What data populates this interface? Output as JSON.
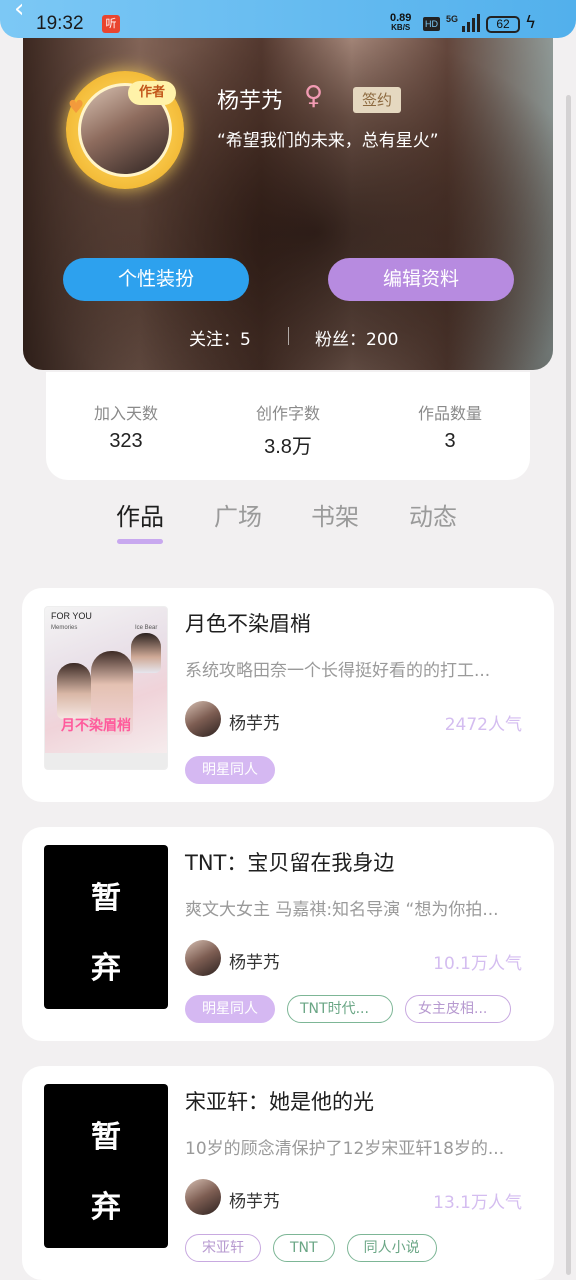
{
  "status_bar": {
    "time": "19:32",
    "app_icon_label": "听",
    "net_speed_value": "0.89",
    "net_speed_unit": "KB/S",
    "hd_label": "HD",
    "signal_label": "5G",
    "battery": "62"
  },
  "profile": {
    "avatar_badge": "作者",
    "name": "杨芋艿",
    "gender_icon": "♀",
    "sign_badge": "签约",
    "bio": "“希望我们的未来，总有星火”",
    "dress_button": "个性装扮",
    "edit_button": "编辑资料",
    "following_label": "关注：",
    "following_count": "5",
    "followers_label": "粉丝：",
    "followers_count": "200"
  },
  "stats": [
    {
      "label": "加入天数",
      "value": "323"
    },
    {
      "label": "创作字数",
      "value": "3.8万"
    },
    {
      "label": "作品数量",
      "value": "3"
    }
  ],
  "tabs": [
    {
      "label": "作品",
      "active": true
    },
    {
      "label": "广场",
      "active": false
    },
    {
      "label": "书架",
      "active": false
    },
    {
      "label": "动态",
      "active": false
    }
  ],
  "works": [
    {
      "title": "月色不染眉梢",
      "description": "系统攻略田奈一个长得挺好看的的打工...",
      "author": "杨芋艿",
      "popularity": "2472人气",
      "cover": {
        "type": "photo",
        "text_top": "FOR YOU",
        "text_sub_left": "Memories",
        "text_sub_right": "Ice Bear",
        "pink_title": "月不染眉梢"
      },
      "tags": [
        {
          "label": "明星同人",
          "style": "purple-fill"
        }
      ]
    },
    {
      "title": "TNT：宝贝留在我身边",
      "description": "爽文大女主 马嘉祺:知名导演 “想为你拍...",
      "author": "杨芋艿",
      "popularity": "10.1万人气",
      "cover": {
        "type": "black",
        "line1": "暂",
        "line2": "弃"
      },
      "tags": [
        {
          "label": "明星同人",
          "style": "purple-fill"
        },
        {
          "label": "TNT时代...",
          "style": "green"
        },
        {
          "label": "女主皮相...",
          "style": "mauve"
        }
      ]
    },
    {
      "title": "宋亚轩：她是他的光",
      "description": "10岁的顾念清保护了12岁宋亚轩18岁的...",
      "author": "杨芋艿",
      "popularity": "13.1万人气",
      "cover": {
        "type": "black",
        "line1": "暂",
        "line2": "弃"
      },
      "tags": [
        {
          "label": "宋亚轩",
          "style": "mauve"
        },
        {
          "label": "TNT",
          "style": "green"
        },
        {
          "label": "同人小说",
          "style": "green"
        }
      ]
    }
  ]
}
